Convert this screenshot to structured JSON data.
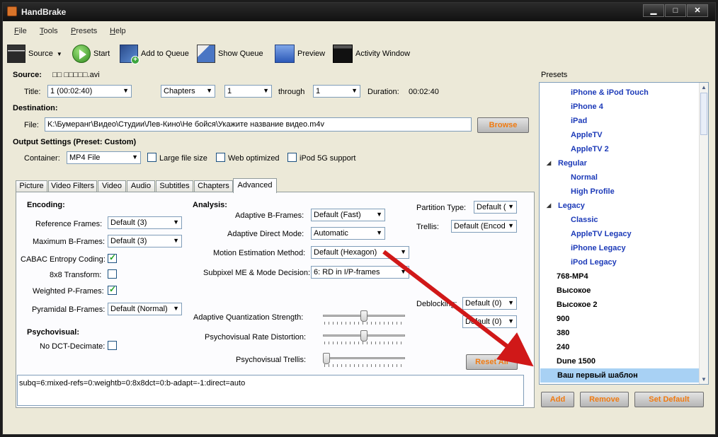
{
  "window": {
    "title": "HandBrake",
    "min_glyph": "▁",
    "max_glyph": "□",
    "close_glyph": "✕"
  },
  "menu": [
    {
      "label_first": "F",
      "label_rest": "ile"
    },
    {
      "label_first": "T",
      "label_rest": "ools"
    },
    {
      "label_first": "P",
      "label_rest": "resets"
    },
    {
      "label_first": "H",
      "label_rest": "elp"
    }
  ],
  "toolbar": {
    "source": "Source",
    "start": "Start",
    "add_to_queue": "Add to Queue",
    "show_queue": "Show Queue",
    "preview": "Preview",
    "activity": "Activity Window"
  },
  "source": {
    "label": "Source:",
    "value": "□□ □□□□□.avi"
  },
  "title_row": {
    "title_label": "Title:",
    "title_value": "1 (00:02:40)",
    "mode_value": "Chapters",
    "from_value": "1",
    "through_label": "through",
    "to_value": "1",
    "duration_label": "Duration:",
    "duration_value": "00:02:40"
  },
  "destination": {
    "heading": "Destination:",
    "file_label": "File:",
    "file_value": "K:\\Бумеранг\\Видео\\Студии\\Лев-Кино\\Не бойся\\Укажите название видео.m4v",
    "browse": "Browse"
  },
  "output": {
    "heading": "Output Settings (Preset: Custom)",
    "container_label": "Container:",
    "container_value": "MP4 File",
    "large_file": "Large file size",
    "web_optimized": "Web optimized",
    "ipod": "iPod 5G support"
  },
  "tabs": [
    "Picture",
    "Video Filters",
    "Video",
    "Audio",
    "Subtitles",
    "Chapters",
    "Advanced"
  ],
  "encoding": {
    "heading": "Encoding:",
    "ref_frames_label": "Reference Frames:",
    "ref_frames_value": "Default (3)",
    "max_b_label": "Maximum B-Frames:",
    "max_b_value": "Default (3)",
    "cabac_label": "CABAC Entropy Coding:",
    "cabac_checked": true,
    "t8x8_label": "8x8 Transform:",
    "t8x8_checked": false,
    "weighted_label": "Weighted P-Frames:",
    "weighted_checked": true,
    "pyramidal_label": "Pyramidal B-Frames:",
    "pyramidal_value": "Default (Normal)"
  },
  "psycho": {
    "heading": "Psychovisual:",
    "no_dct_label": "No DCT-Decimate:",
    "no_dct_checked": false
  },
  "analysis": {
    "heading": "Analysis:",
    "adaptive_b_label": "Adaptive B-Frames:",
    "adaptive_b_value": "Default (Fast)",
    "direct_label": "Adaptive Direct Mode:",
    "direct_value": "Automatic",
    "motion_label": "Motion Estimation Method:",
    "motion_value": "Default (Hexagon)",
    "subpixel_label": "Subpixel ME & Mode Decision:",
    "subpixel_value": "6: RD in I/P-frames",
    "partition_label": "Partition Type:",
    "partition_value": "Default (",
    "trellis_label": "Trellis:",
    "trellis_value": "Default (Encod",
    "deblocking_label": "Deblocking:",
    "deblock1_value": "Default (0)",
    "deblock2_value": "Default (0)",
    "aq_label": "Adaptive Quantization Strength:",
    "aq_level": 0.5,
    "rd_label": "Psychovisual Rate Distortion:",
    "rd_level": 0.5,
    "trellis_slider_label": "Psychovisual Trellis:",
    "trellis_level": 0.0,
    "reset": "Reset All"
  },
  "query": "subq=6:mixed-refs=0:weightb=0:8x8dct=0:b-adapt=-1:direct=auto",
  "presets": {
    "heading": "Presets",
    "items": [
      {
        "label": "iPhone & iPod Touch",
        "kind": "child"
      },
      {
        "label": "iPhone 4",
        "kind": "child"
      },
      {
        "label": "iPad",
        "kind": "child"
      },
      {
        "label": "AppleTV",
        "kind": "child"
      },
      {
        "label": "AppleTV 2",
        "kind": "child"
      },
      {
        "label": "Regular",
        "kind": "group"
      },
      {
        "label": "Normal",
        "kind": "child"
      },
      {
        "label": "High Profile",
        "kind": "child"
      },
      {
        "label": "Legacy",
        "kind": "group"
      },
      {
        "label": "Classic",
        "kind": "child"
      },
      {
        "label": "AppleTV Legacy",
        "kind": "child"
      },
      {
        "label": "iPhone Legacy",
        "kind": "child"
      },
      {
        "label": "iPod Legacy",
        "kind": "child"
      },
      {
        "label": "768-MP4",
        "kind": "root"
      },
      {
        "label": "Высокое",
        "kind": "root"
      },
      {
        "label": "Высокое 2",
        "kind": "root"
      },
      {
        "label": "900",
        "kind": "root"
      },
      {
        "label": "380",
        "kind": "root"
      },
      {
        "label": "240",
        "kind": "root"
      },
      {
        "label": "Dune 1500",
        "kind": "root"
      },
      {
        "label": "Ваш первый шаблон",
        "kind": "root",
        "selected": true
      }
    ],
    "add": "Add",
    "remove": "Remove",
    "set_default": "Set Default"
  },
  "colors": {
    "arrow": "#d01818",
    "accent_orange": "#f07a10",
    "preset_blue": "#1c3ab8",
    "selection": "#a8d1f4"
  }
}
